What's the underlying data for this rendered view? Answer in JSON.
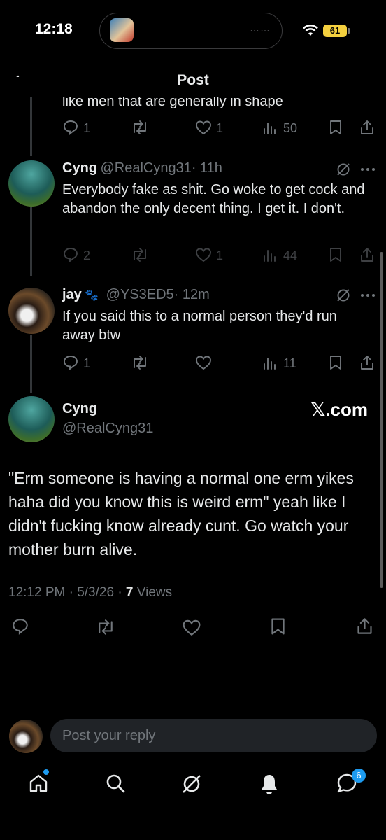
{
  "status_bar": {
    "time": "12:18",
    "battery": "61",
    "island_dots": "……"
  },
  "header": {
    "title": "Post"
  },
  "replies": [
    {
      "text_partial": "like men that are generally in shape",
      "metrics": {
        "replies": "1",
        "likes": "1",
        "views": "50"
      }
    },
    {
      "name": "Cyng",
      "handle": "@RealCyng31",
      "time": "· 11h",
      "text": "Everybody fake as shit. Go woke to get cock and abandon the only decent thing. I get it. I don't.",
      "metrics": {
        "replies": "2",
        "likes": "1",
        "views": "44"
      }
    },
    {
      "name": "jay",
      "name_emoji": "🐾",
      "handle": "@YS3ED5",
      "time": "· 12m",
      "text": "If you said this to a normal person they'd run away btw",
      "metrics": {
        "replies": "1",
        "views": "11"
      }
    }
  ],
  "main_post": {
    "name": "Cyng",
    "handle": "@RealCyng31",
    "watermark": "𝕏.com",
    "text": "\"Erm someone is having a normal one erm yikes haha did you know this is weird erm\" yeah like I didn't fucking know already cunt. Go watch your mother burn alive.",
    "timestamp": "12:12 PM · 5/3/26 · ",
    "views_count": "7",
    "views_label": " Views"
  },
  "reply_bar": {
    "placeholder": "Post your reply"
  },
  "tab_bar": {
    "messages_badge": "6"
  }
}
